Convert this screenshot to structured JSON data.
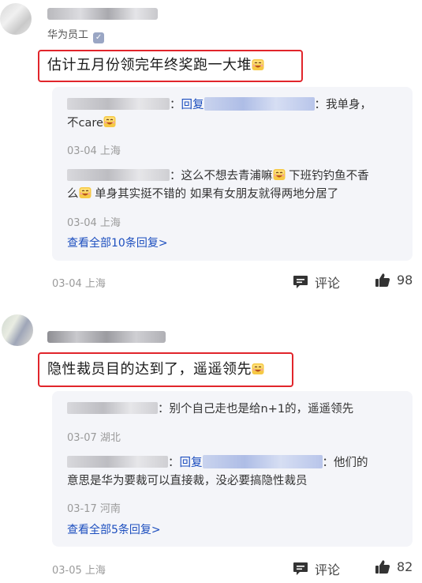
{
  "comments": [
    {
      "author_badge": "华为员工",
      "content": "估计五月份领完年终奖跑一大堆",
      "replies": [
        {
          "reply_word": "回复",
          "text_line1": "：我单身，",
          "text_line2": "不care",
          "meta": "03-04 上海"
        },
        {
          "text_line1": "：这么不想去青浦嘛",
          "text_line1b": "下班钓钓鱼不香",
          "text_line2a": "么",
          "text_line2b": "单身其实挺不错的 如果有女朋友就得两地分居了",
          "meta": "03-04 上海"
        }
      ],
      "view_all": "查看全部10条回复>",
      "meta": "03-04 上海",
      "comment_label": "评论",
      "likes": "98"
    },
    {
      "content": "隐性裁员目的达到了，遥遥领先",
      "replies": [
        {
          "text_line1": "：别个自己走也是给n+1的，遥遥领先",
          "meta": "03-07 湖北"
        },
        {
          "reply_word": "回复",
          "text_line1": "：他们的",
          "text_line2": "意思是华为要裁可以直接裁，没必要搞隐性裁员",
          "meta": "03-17 河南"
        }
      ],
      "view_all": "查看全部5条回复>",
      "meta": "03-05 上海",
      "comment_label": "评论",
      "likes": "82"
    }
  ],
  "icons": {
    "verified": "verified-badge-icon",
    "comment": "comment-icon",
    "like": "thumbs-up-icon",
    "emoji": "laughing-emoji-icon"
  },
  "colors": {
    "highlight": "#e1252b",
    "link": "#1d4fbf",
    "reply_bg": "#f4f5f9"
  }
}
